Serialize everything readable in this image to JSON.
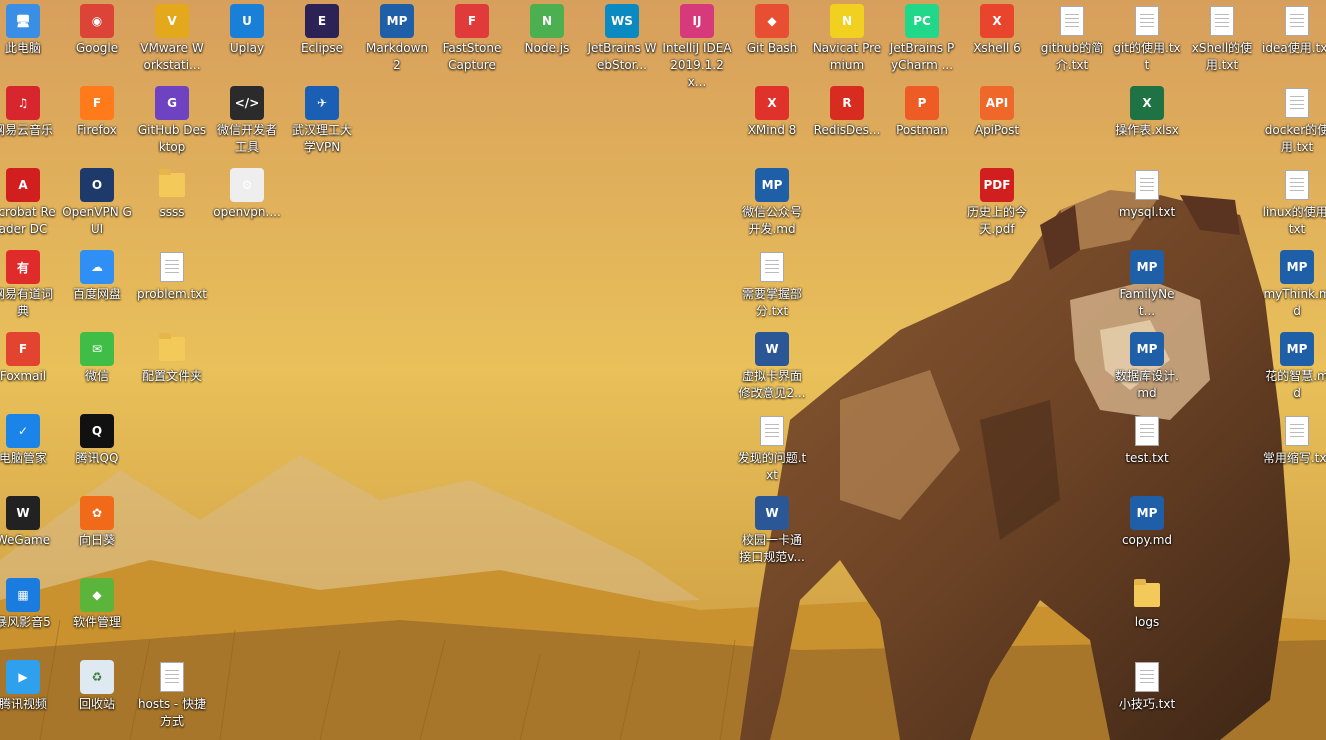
{
  "desktop": {
    "watermark": "",
    "col1": [
      {
        "label": "此电脑",
        "icon": "computer-icon",
        "color": "#3a8ee6"
      },
      {
        "label": "网易云音乐",
        "icon": "netease-music-icon",
        "color": "#d8262f"
      },
      {
        "label": "Acrobat Reader DC",
        "icon": "acrobat-icon",
        "color": "#d11f1f"
      },
      {
        "label": "网易有道词典",
        "icon": "youdao-icon",
        "color": "#e02b2b"
      },
      {
        "label": "Foxmail",
        "icon": "foxmail-icon",
        "color": "#e2442f"
      },
      {
        "label": "电脑管家",
        "icon": "pc-manager-icon",
        "color": "#1b84e8"
      },
      {
        "label": "WeGame",
        "icon": "wegame-icon",
        "color": "#222222"
      },
      {
        "label": "暴风影音5",
        "icon": "baofeng-icon",
        "color": "#1b7ce0"
      },
      {
        "label": "腾讯视频",
        "icon": "tencent-video-icon",
        "color": "#2fa0ee"
      }
    ],
    "col2": [
      {
        "label": "Google",
        "icon": "chrome-icon",
        "color": "#db4437"
      },
      {
        "label": "Firefox",
        "icon": "firefox-icon",
        "color": "#ff7a1a"
      },
      {
        "label": "OpenVPN GUI",
        "icon": "openvpn-icon",
        "color": "#1d3a6b"
      },
      {
        "label": "百度网盘",
        "icon": "baidu-pan-icon",
        "color": "#2f8ff5"
      },
      {
        "label": "微信",
        "icon": "wechat-icon",
        "color": "#3fbd46"
      },
      {
        "label": "腾讯QQ",
        "icon": "qq-icon",
        "color": "#111111"
      },
      {
        "label": "向日葵",
        "icon": "sunflower-icon",
        "color": "#f06a1a"
      },
      {
        "label": "软件管理",
        "icon": "software-manager-icon",
        "color": "#5bb53a"
      },
      {
        "label": "回收站",
        "icon": "recycle-bin-icon",
        "color": "#dfe9f2"
      }
    ],
    "col3": [
      {
        "label": "VMware Workstati...",
        "icon": "vmware-icon",
        "color": "#e3a81b"
      },
      {
        "label": "GitHub Desktop",
        "icon": "github-desktop-icon",
        "color": "#6f42c1"
      },
      {
        "label": "ssss",
        "icon": "folder-icon",
        "color": "#f3c95a"
      },
      {
        "label": "problem.txt",
        "icon": "text-file-icon",
        "color": "#ffffff"
      },
      {
        "label": "配置文件夹",
        "icon": "folder-icon",
        "color": "#f3c95a"
      },
      {
        "label": "hosts - 快捷方式",
        "icon": "shortcut-file-icon",
        "color": "#ffffff"
      }
    ],
    "col4": [
      {
        "label": "Uplay",
        "icon": "uplay-icon",
        "color": "#1a7fd6"
      },
      {
        "label": "微信开发者工具",
        "icon": "wechat-devtools-icon",
        "color": "#2b2b2b"
      },
      {
        "label": "openvpn....",
        "icon": "config-file-icon",
        "color": "#eeeeee"
      }
    ],
    "col5": [
      {
        "label": "Eclipse",
        "icon": "eclipse-icon",
        "color": "#2c2255"
      },
      {
        "label": "武汉理工大学VPN",
        "icon": "vpn-icon",
        "color": "#1a5fb4"
      }
    ],
    "top_row": [
      {
        "label": "Markdown 2",
        "icon": "markdownpad-icon",
        "color": "#1f5fa8"
      },
      {
        "label": "FastStone Capture",
        "icon": "faststone-icon",
        "color": "#e03a3a"
      },
      {
        "label": "Node.js",
        "icon": "nodejs-icon",
        "color": "#4caf50"
      },
      {
        "label": "JetBrains WebStor...",
        "icon": "webstorm-icon",
        "color": "#0b8ac1"
      },
      {
        "label": "IntelliJ IDEA 2019.1.2 x...",
        "icon": "intellij-icon",
        "color": "#d63a7a"
      },
      {
        "label": "Git Bash",
        "icon": "git-bash-icon",
        "color": "#e84e31"
      },
      {
        "label": "Navicat Premium",
        "icon": "navicat-icon",
        "color": "#f2d020"
      },
      {
        "label": "JetBrains PyCharm ...",
        "icon": "pycharm-icon",
        "color": "#21d789"
      },
      {
        "label": "Xshell 6",
        "icon": "xshell-icon",
        "color": "#e8452c"
      },
      {
        "label": "github的简介.txt",
        "icon": "text-file-icon",
        "color": "#ffffff"
      },
      {
        "label": "git的使用.txt",
        "icon": "text-file-icon",
        "color": "#ffffff"
      },
      {
        "label": "xShell的使用.txt",
        "icon": "text-file-icon",
        "color": "#ffffff"
      },
      {
        "label": "idea使用.txt",
        "icon": "text-file-icon",
        "color": "#ffffff"
      }
    ],
    "row2": [
      {
        "label": "XMind 8",
        "icon": "xmind-icon",
        "color": "#e0312b"
      },
      {
        "label": "RedisDes...",
        "icon": "redis-icon",
        "color": "#d82c20"
      },
      {
        "label": "Postman",
        "icon": "postman-icon",
        "color": "#ef5b25"
      },
      {
        "label": "ApiPost",
        "icon": "apipost-icon",
        "color": "#f0672a"
      }
    ],
    "col_mid": [
      {
        "label": "微信公众号开发.md",
        "icon": "markdown-file-icon",
        "color": "#1f5fa8"
      },
      {
        "label": "需要掌握部分.txt",
        "icon": "text-file-icon",
        "color": "#ffffff"
      },
      {
        "label": "虚拟卡界面修改意见2...",
        "icon": "word-file-icon",
        "color": "#2b5797"
      },
      {
        "label": "发现的问题.txt",
        "icon": "text-file-icon",
        "color": "#ffffff"
      },
      {
        "label": "校园一卡通接口规范v...",
        "icon": "word-file-icon",
        "color": "#2b5797"
      }
    ],
    "pdf": {
      "label": "历史上的今天.pdf",
      "icon": "pdf-file-icon",
      "color": "#d11f1f"
    },
    "col_r1": [
      {
        "label": "操作表.xlsx",
        "icon": "excel-file-icon",
        "color": "#1f7244"
      },
      {
        "label": "mysql.txt",
        "icon": "text-file-icon",
        "color": "#ffffff"
      },
      {
        "label": "FamilyNet...",
        "icon": "markdown-file-icon",
        "color": "#1f5fa8"
      },
      {
        "label": "数据库设计.md",
        "icon": "markdown-file-icon",
        "color": "#1f5fa8"
      },
      {
        "label": "test.txt",
        "icon": "text-file-icon",
        "color": "#ffffff"
      },
      {
        "label": "copy.md",
        "icon": "markdown-file-icon",
        "color": "#1f5fa8"
      },
      {
        "label": "logs",
        "icon": "folder-icon",
        "color": "#f3c95a"
      },
      {
        "label": "小技巧.txt",
        "icon": "text-file-icon",
        "color": "#ffffff"
      }
    ],
    "col_r2": [
      {
        "label": "docker的使用.txt",
        "icon": "text-file-icon",
        "color": "#ffffff"
      },
      {
        "label": "linux的使用.txt",
        "icon": "text-file-icon",
        "color": "#ffffff"
      },
      {
        "label": "myThink.md",
        "icon": "markdown-file-icon",
        "color": "#1f5fa8"
      },
      {
        "label": "花的智慧.md",
        "icon": "markdown-file-icon",
        "color": "#1f5fa8"
      },
      {
        "label": "常用缩写.txt",
        "icon": "text-file-icon",
        "color": "#ffffff"
      }
    ]
  }
}
